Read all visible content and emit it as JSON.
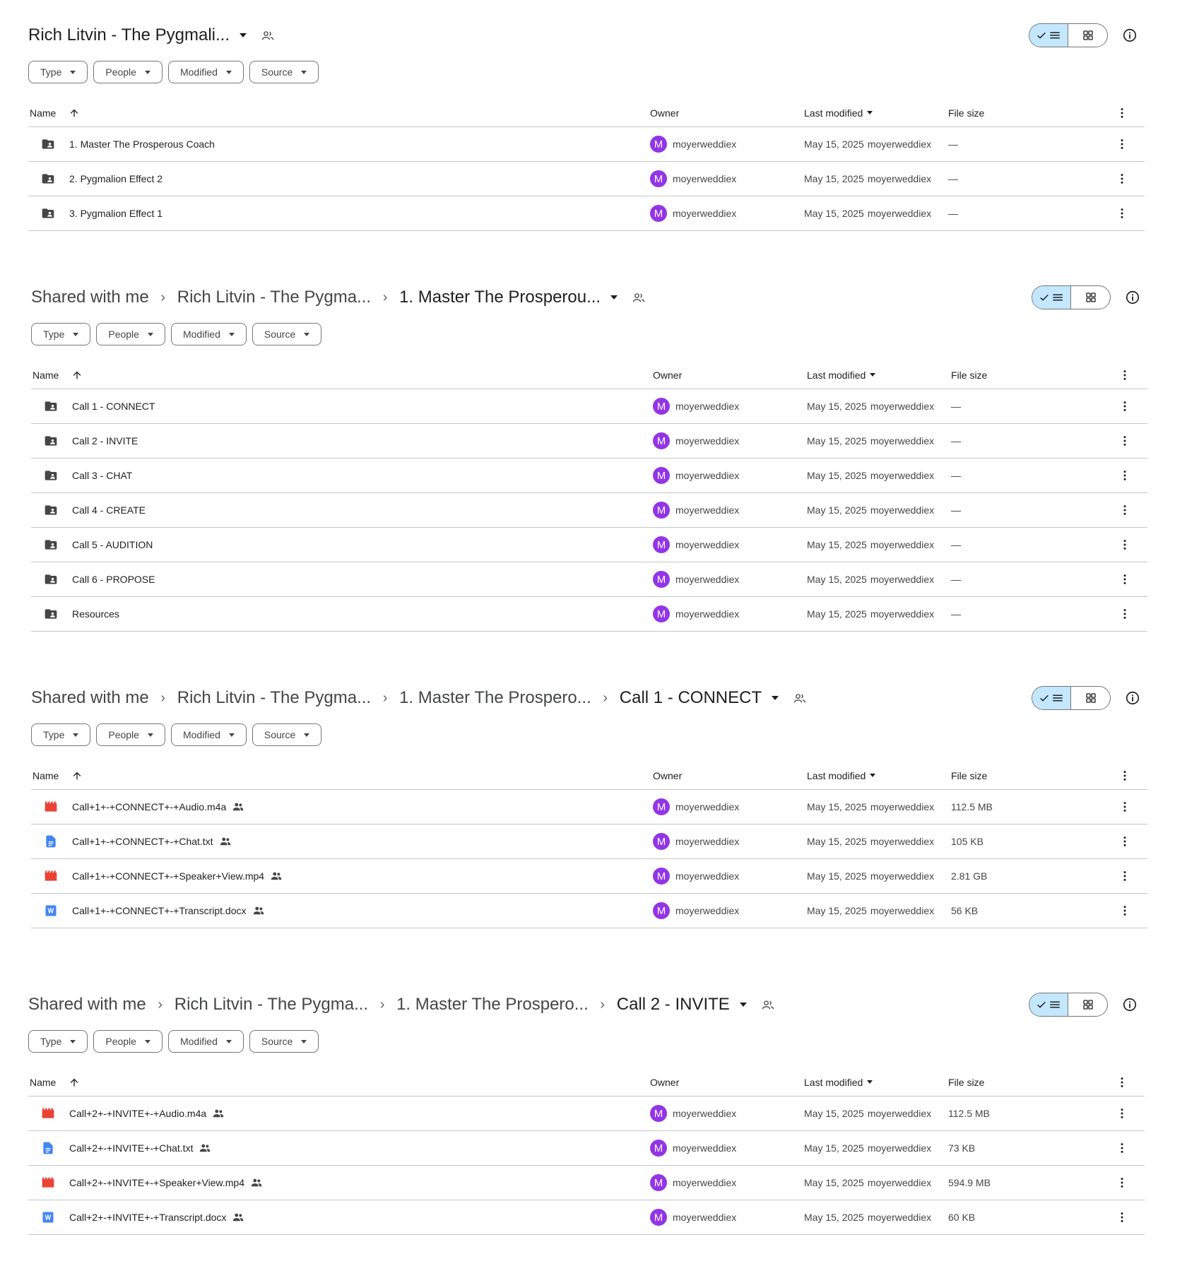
{
  "common": {
    "filters": [
      "Type",
      "People",
      "Modified",
      "Source"
    ],
    "headers": {
      "name": "Name",
      "owner": "Owner",
      "modified": "Last modified",
      "size": "File size"
    },
    "owner_initial": "M",
    "owner": "moyerweddiex",
    "date": "May 15, 2025",
    "modified_by": "moyerweddiex",
    "dash": "—"
  },
  "colors": {
    "avatar": "#9334e6",
    "toggle_active": "#c2e7ff",
    "video_icon": "#ea4335",
    "doc_icon": "#4285f4"
  },
  "panels": [
    {
      "crumbs": [],
      "current": "Rich Litvin - The Pygmali...",
      "rows": [
        {
          "icon": "shared-folder-icon",
          "name": "1. Master The Prosperous Coach",
          "size": "—",
          "shared": false
        },
        {
          "icon": "shared-folder-icon",
          "name": "2. Pygmalion Effect 2",
          "size": "—",
          "shared": false
        },
        {
          "icon": "shared-folder-icon",
          "name": "3. Pygmalion Effect 1",
          "size": "—",
          "shared": false
        }
      ]
    },
    {
      "crumbs": [
        "Shared with me",
        "Rich Litvin - The Pygma..."
      ],
      "current": "1. Master The Prosperou...",
      "rows": [
        {
          "icon": "shared-folder-icon",
          "name": "Call 1 - CONNECT",
          "size": "—",
          "shared": false
        },
        {
          "icon": "shared-folder-icon",
          "name": "Call 2 - INVITE",
          "size": "—",
          "shared": false
        },
        {
          "icon": "shared-folder-icon",
          "name": "Call 3 - CHAT",
          "size": "—",
          "shared": false
        },
        {
          "icon": "shared-folder-icon",
          "name": "Call 4 - CREATE",
          "size": "—",
          "shared": false
        },
        {
          "icon": "shared-folder-icon",
          "name": "Call 5 - AUDITION",
          "size": "—",
          "shared": false
        },
        {
          "icon": "shared-folder-icon",
          "name": "Call 6 - PROPOSE",
          "size": "—",
          "shared": false
        },
        {
          "icon": "shared-folder-icon",
          "name": "Resources",
          "size": "—",
          "shared": false
        }
      ]
    },
    {
      "crumbs": [
        "Shared with me",
        "Rich Litvin - The Pygma...",
        "1. Master The Prospero..."
      ],
      "current": "Call 1 - CONNECT",
      "rows": [
        {
          "icon": "video-file-icon",
          "name": "Call+1+-+CONNECT+-+Audio.m4a",
          "size": "112.5 MB",
          "shared": true
        },
        {
          "icon": "text-file-icon",
          "name": "Call+1+-+CONNECT+-+Chat.txt",
          "size": "105 KB",
          "shared": true
        },
        {
          "icon": "video-file-icon",
          "name": "Call+1+-+CONNECT+-+Speaker+View.mp4",
          "size": "2.81 GB",
          "shared": true
        },
        {
          "icon": "word-file-icon",
          "name": "Call+1+-+CONNECT+-+Transcript.docx",
          "size": "56 KB",
          "shared": true
        }
      ]
    },
    {
      "crumbs": [
        "Shared with me",
        "Rich Litvin - The Pygma...",
        "1. Master The Prospero..."
      ],
      "current": "Call 2 - INVITE",
      "rows": [
        {
          "icon": "video-file-icon",
          "name": "Call+2+-+INVITE+-+Audio.m4a",
          "size": "112.5 MB",
          "shared": true
        },
        {
          "icon": "text-file-icon",
          "name": "Call+2+-+INVITE+-+Chat.txt",
          "size": "73 KB",
          "shared": true
        },
        {
          "icon": "video-file-icon",
          "name": "Call+2+-+INVITE+-+Speaker+View.mp4",
          "size": "594.9 MB",
          "shared": true
        },
        {
          "icon": "word-file-icon",
          "name": "Call+2+-+INVITE+-+Transcript.docx",
          "size": "60 KB",
          "shared": true
        }
      ]
    }
  ]
}
